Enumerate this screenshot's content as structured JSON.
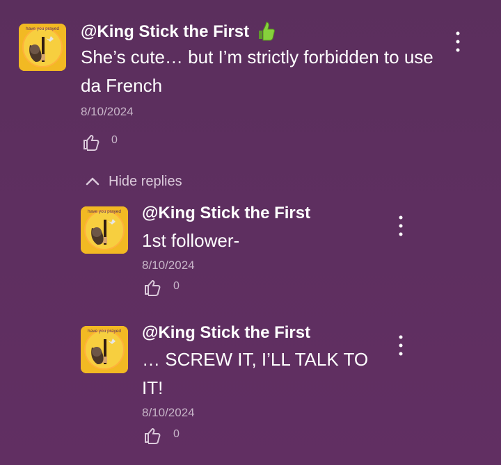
{
  "comment": {
    "author": "@King Stick the First",
    "emoji_icon": "thumbs-up-emoji",
    "text": "She’s cute… but I’m strictly forbidden to use da French",
    "date": "8/10/2024",
    "likes": "0",
    "menu_icon": "more-vert-icon",
    "avatar_text": "have you prayed"
  },
  "replies_toggle": {
    "label": "Hide replies",
    "icon": "chevron-up-icon"
  },
  "replies": [
    {
      "author": "@King Stick the First",
      "text": "1st follower-",
      "date": "8/10/2024",
      "likes": "0",
      "avatar_text": "have you prayed"
    },
    {
      "author": "@King Stick the First",
      "text": "… SCREW IT, I’LL TALK TO IT!",
      "date": "8/10/2024",
      "likes": "0",
      "avatar_text": "have you prayed"
    }
  ],
  "colors": {
    "background": "#5e2f60",
    "text": "#ffffff",
    "muted": "#c7b5c8",
    "avatar_bg": "#f6c21a"
  }
}
